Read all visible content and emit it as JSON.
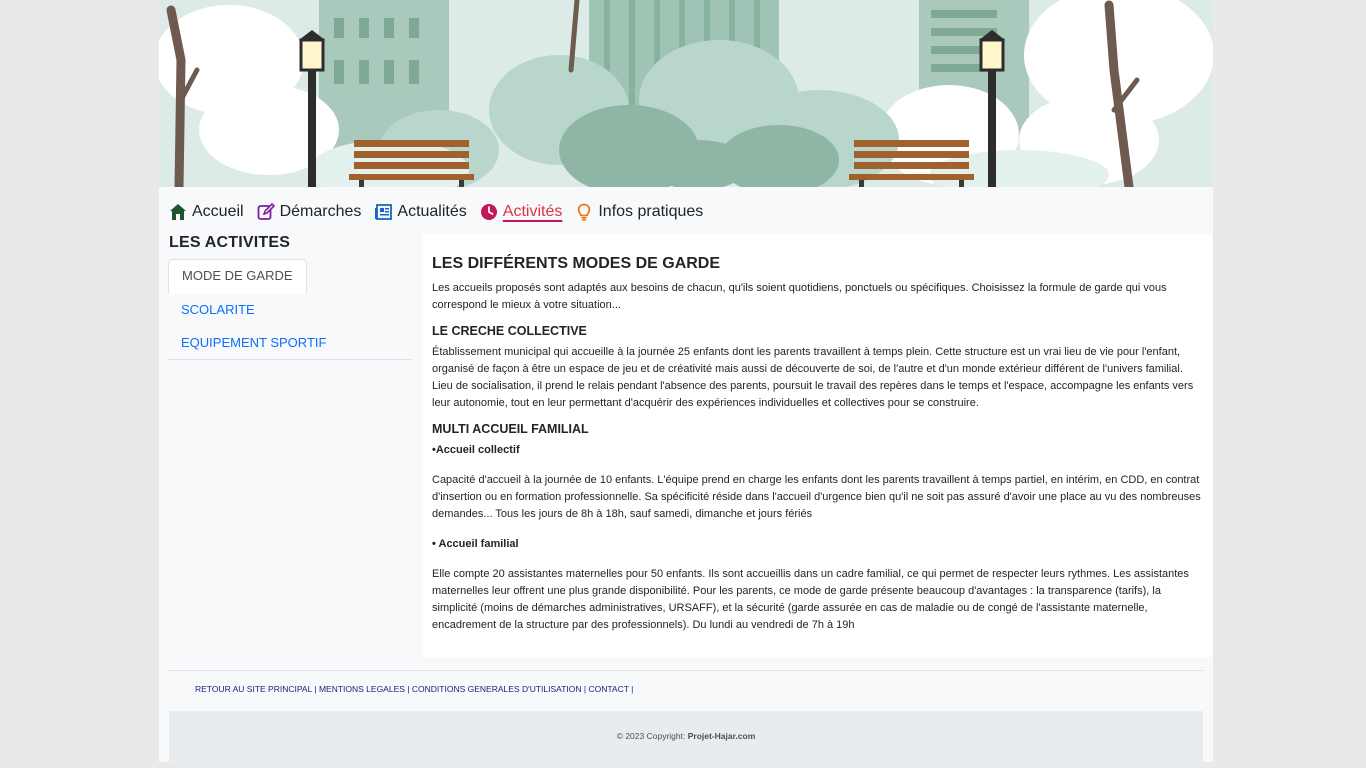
{
  "nav": [
    {
      "label": "Accueil",
      "icon": "home-icon",
      "color": "#1e5631"
    },
    {
      "label": "Démarches",
      "icon": "edit-icon",
      "color": "#7b1fa2"
    },
    {
      "label": "Actualités",
      "icon": "newspaper-icon",
      "color": "#1565c0"
    },
    {
      "label": "Activités",
      "icon": "clock-icon",
      "color": "#c2185b",
      "active": true
    },
    {
      "label": "Infos pratiques",
      "icon": "lightbulb-icon",
      "color": "#ef6c00"
    }
  ],
  "sidebar": {
    "title": "LES ACTIVITES",
    "items": [
      {
        "label": "MODE DE GARDE"
      },
      {
        "label": "SCOLARITE"
      },
      {
        "label": "EQUIPEMENT SPORTIF"
      }
    ]
  },
  "content": {
    "title": "LES DIFFÉRENTS MODES DE GARDE",
    "intro": "Les accueils proposés sont adaptés aux besoins de chacun, qu'ils soient quotidiens, ponctuels ou spécifiques. Choisissez la formule de garde qui vous correspond le mieux à votre situation...",
    "section1_title": "LE CRECHE COLLECTIVE",
    "section1_text": "Établissement municipal qui accueille à la journée 25 enfants dont les parents travaillent à temps plein. Cette structure est un vrai lieu de vie pour l'enfant, organisé de façon à être un espace de jeu et de créativité mais aussi de découverte de soi, de l'autre et d'un monde extérieur différent de l'univers familial. Lieu de socialisation, il prend le relais pendant l'absence des parents, poursuit le travail des repères dans le temps et l'espace, accompagne les enfants vers leur autonomie, tout en leur permettant d'acquérir des expériences individuelles et collectives pour se construire.",
    "section2_title": "MULTI ACCUEIL FAMILIAL",
    "sub1_title": "•Accueil collectif",
    "sub1_text": "Capacité d'accueil à la journée de 10 enfants. L'équipe prend en charge les enfants dont les parents travaillent à temps partiel, en intérim, en CDD, en contrat d'insertion ou en formation professionnelle. Sa spécificité réside dans l'accueil d'urgence bien qu'il ne soit pas assuré d'avoir une place au vu des nombreuses demandes... Tous les jours de 8h à 18h, sauf samedi, dimanche et jours fériés",
    "sub2_title": "• Accueil familial",
    "sub2_text": "Elle compte 20 assistantes maternelles pour 50 enfants. Ils sont accueillis dans un cadre familial, ce qui permet de respecter leurs rythmes. Les assistantes maternelles leur offrent une plus grande disponibilité. Pour les parents, ce mode de garde présente beaucoup d'avantages : la transparence (tarifs), la simplicité (moins de démarches administratives, URSAFF), et la sécurité (garde assurée en cas de maladie ou de congé de l'assistante maternelle, encadrement de la structure par des professionnels). Du lundi au vendredi de 7h à 19h"
  },
  "footer": {
    "links": [
      "RETOUR AU SITE PRINCIPAL",
      "MENTIONS LEGALES",
      "CONDITIONS GENERALES D'UTILISATION",
      "CONTACT"
    ],
    "separator": "|",
    "copyright_prefix": "© 2023 Copyright:",
    "copyright_site": "Projet-Hajar.com"
  },
  "colors": {
    "active": "#dc3545",
    "link": "#0d6efd",
    "footer_link": "#1a237e"
  }
}
